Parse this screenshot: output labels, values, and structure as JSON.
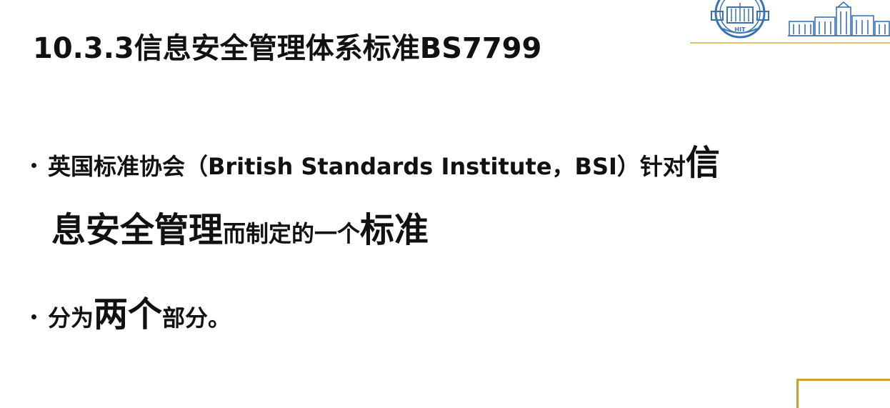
{
  "slide": {
    "title": "10.3.3信息安全管理体系标准BS7799",
    "logo_emblem_text": "HIT",
    "bullet1": {
      "part1": "英国标准协会（British  Standards  Institute，BSI）针对",
      "emph1": "信",
      "emph2": "息安全管理",
      "part2": "而制定的一个",
      "emph3": "标准"
    },
    "bullet2": {
      "part1": "分为",
      "emph": "两个",
      "part2": "部分。"
    },
    "colors": {
      "accent_gold": "#c9a227",
      "rule_gold": "#e3c26a",
      "logo_blue": "#3a72b5"
    }
  }
}
